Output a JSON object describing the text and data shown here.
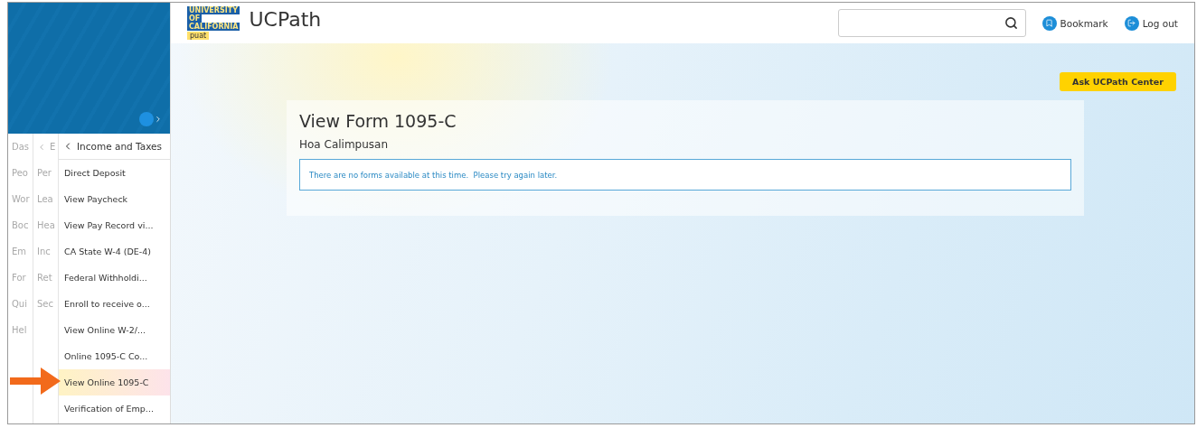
{
  "logo": {
    "lines": [
      "UNIVERSITY",
      "OF",
      "CALIFORNIA"
    ],
    "badge": "puat",
    "title": "UCPath"
  },
  "header": {
    "links": [
      {
        "kind": "bookmark",
        "label": "Bookmark"
      },
      {
        "kind": "logout",
        "label": "Log out"
      }
    ]
  },
  "sidebar": {
    "columns": [
      {
        "kind": "root",
        "title": "Das",
        "items": [
          {
            "label": "Peo",
            "selected": false
          },
          {
            "label": "Wor",
            "selected": false
          },
          {
            "label": "Boc",
            "selected": false
          },
          {
            "label": "Em",
            "selected": false
          },
          {
            "label": "For",
            "selected": false
          },
          {
            "label": "Qui",
            "selected": false
          },
          {
            "label": "Hel",
            "selected": false
          }
        ]
      },
      {
        "kind": "submenu",
        "title": "E",
        "items": [
          {
            "label": "Per",
            "selected": false
          },
          {
            "label": "Lea",
            "selected": false
          },
          {
            "label": "Hea",
            "selected": false
          },
          {
            "label": "Inc",
            "selected": false
          },
          {
            "label": "Ret",
            "selected": false
          },
          {
            "label": "Sec",
            "selected": false
          }
        ]
      },
      {
        "kind": "submenu",
        "title": "Income and Taxes",
        "items": [
          {
            "label": "Direct Deposit",
            "selected": false
          },
          {
            "label": "View Paycheck",
            "selected": false
          },
          {
            "label": "View Pay Record vi...",
            "selected": false
          },
          {
            "label": "CA State W-4 (DE-4)",
            "selected": false
          },
          {
            "label": "Federal Withholdi...",
            "selected": false
          },
          {
            "label": "Enroll to receive o...",
            "selected": false
          },
          {
            "label": "View Online W-2/...",
            "selected": false
          },
          {
            "label": "Online 1095-C Co...",
            "selected": false
          },
          {
            "label": "View Online 1095-C",
            "selected": true
          },
          {
            "label": "Verification of Emp...",
            "selected": false
          }
        ]
      }
    ]
  },
  "ask_button": "Ask UCPath Center",
  "card": {
    "title": "View Form 1095-C",
    "name": "Hoa Calimpusan",
    "message": "There are no forms available at this time.  Please try again later."
  }
}
